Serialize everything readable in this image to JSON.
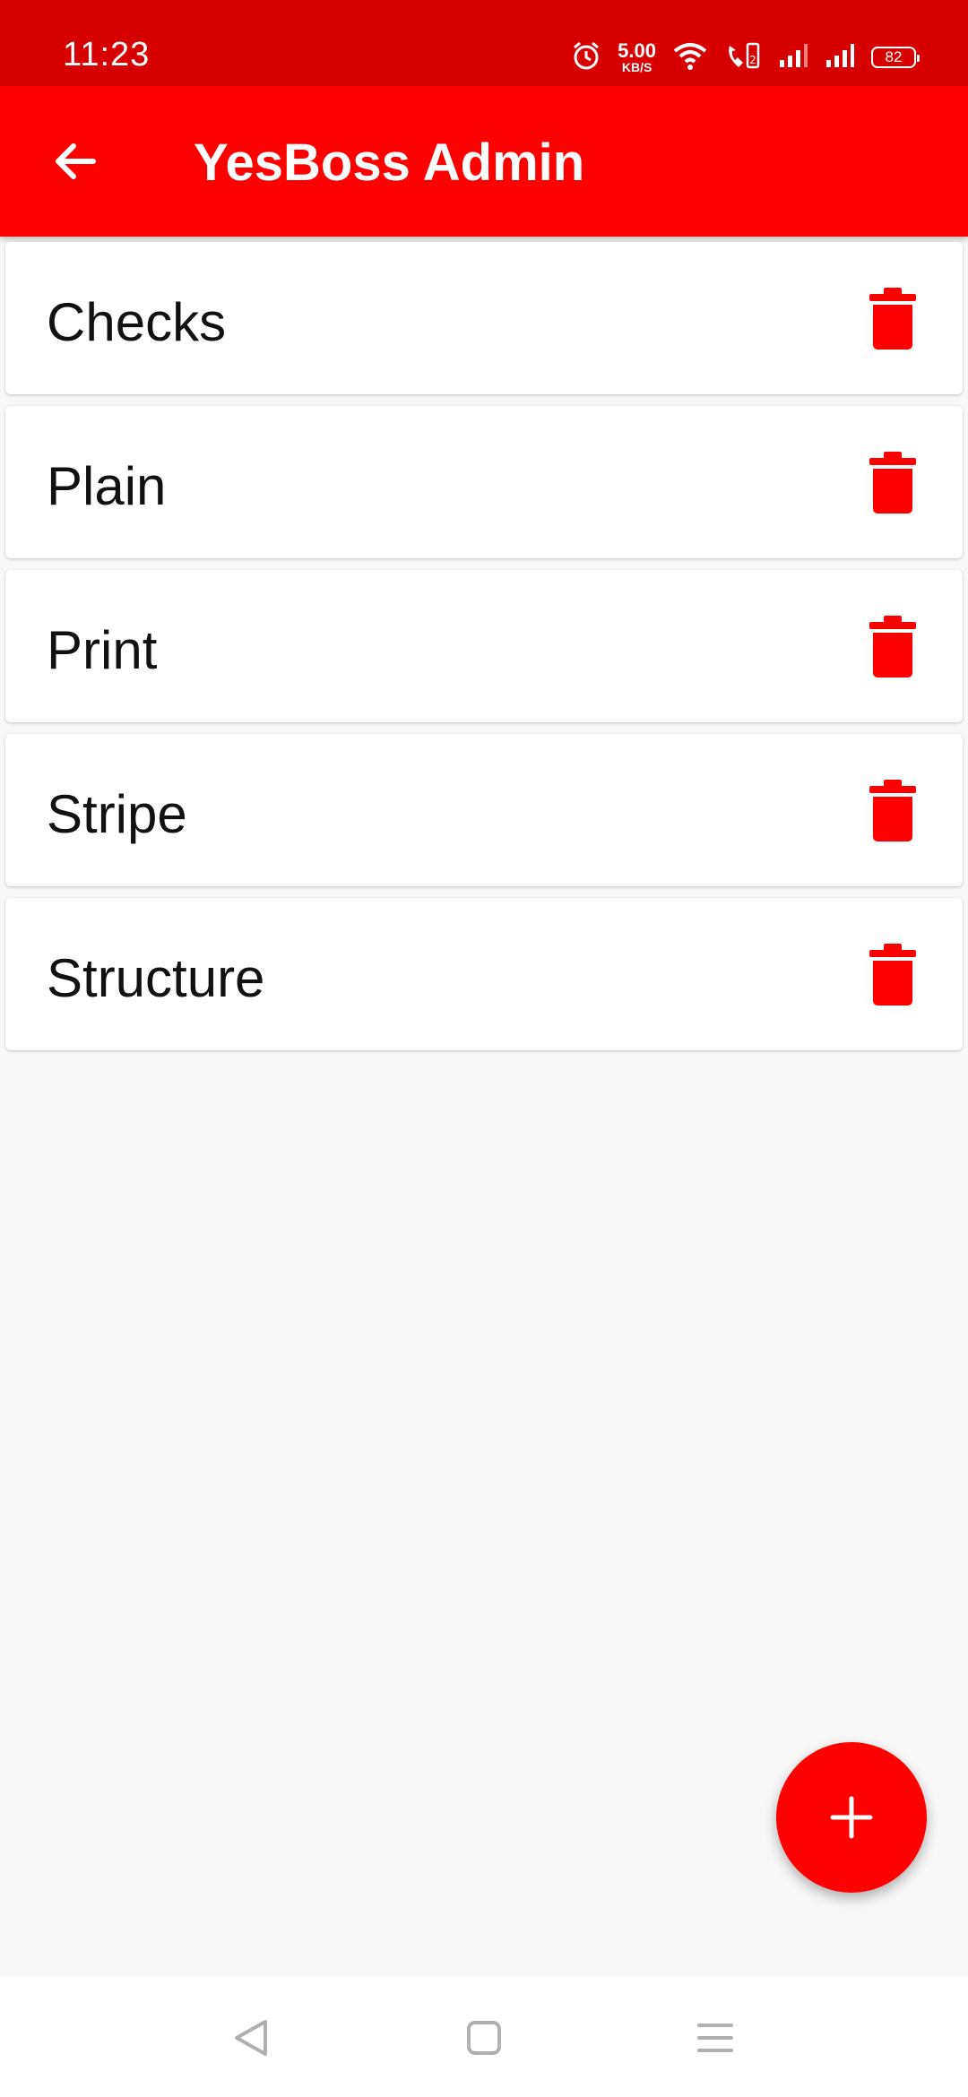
{
  "status_bar": {
    "time": "11:23",
    "net_speed_value": "5.00",
    "net_speed_unit": "KB/S",
    "battery": "82",
    "icons": [
      "alarm-icon",
      "wifi-icon",
      "volte-call-icon",
      "signal-icon",
      "signal-icon"
    ]
  },
  "app_bar": {
    "title": "YesBoss Admin",
    "back_icon": "arrow-left-icon",
    "color": "#ff0000"
  },
  "items": [
    {
      "label": "Checks"
    },
    {
      "label": "Plain"
    },
    {
      "label": "Print"
    },
    {
      "label": "Stripe"
    },
    {
      "label": "Structure"
    }
  ],
  "delete_icon": "trash-icon",
  "fab": {
    "icon": "plus-icon"
  },
  "nav_bar": {
    "icons": [
      "back-triangle-icon",
      "home-square-icon",
      "menu-lines-icon"
    ]
  },
  "colors": {
    "status_bar": "#d60000",
    "accent": "#ff0000",
    "background": "#f8f8f8"
  }
}
